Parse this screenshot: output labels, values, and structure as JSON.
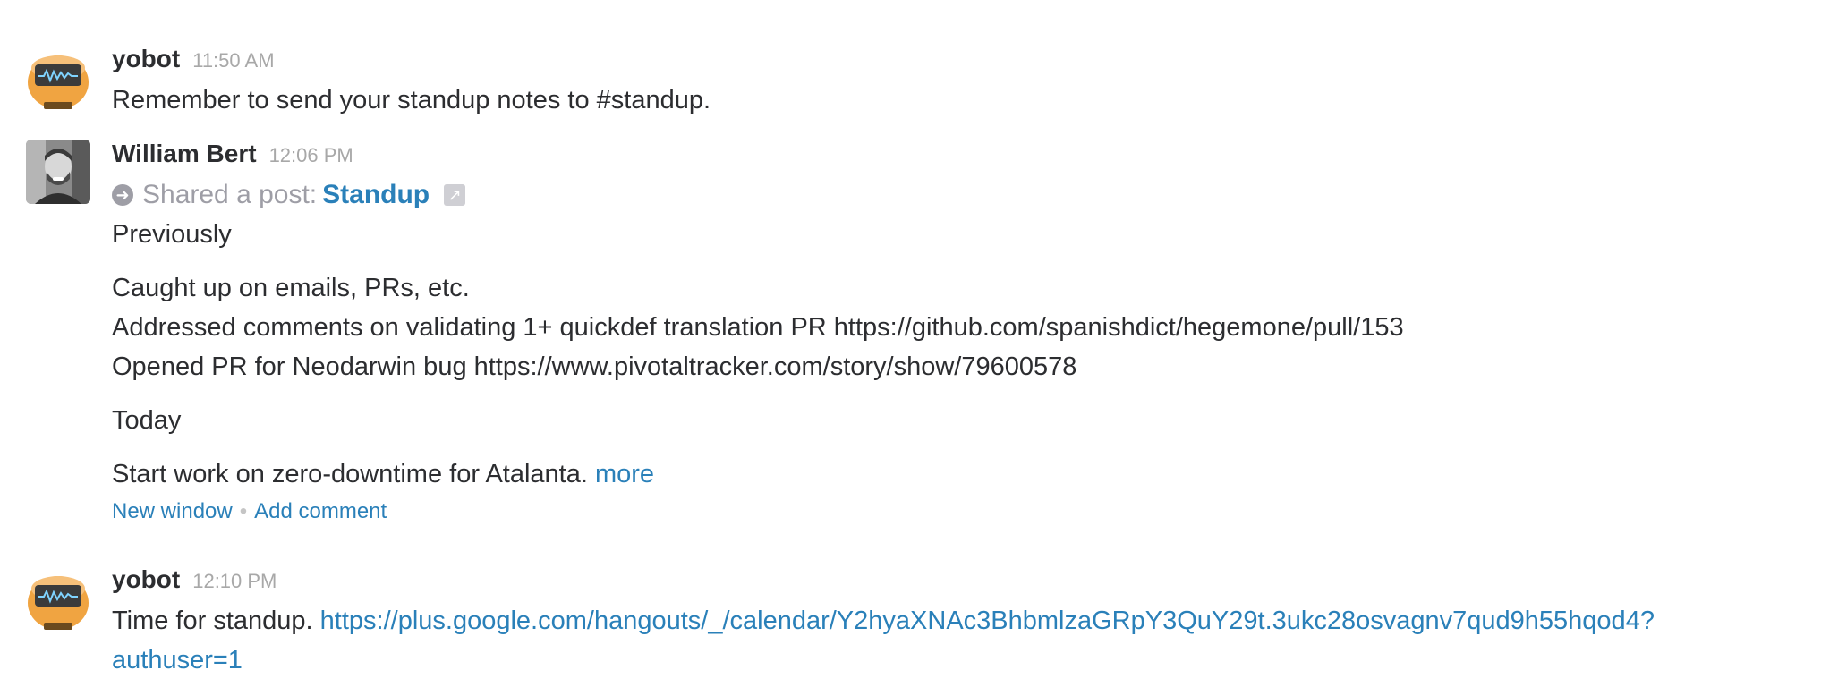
{
  "messages": [
    {
      "sender": "yobot",
      "time": "11:50 AM",
      "text": "Remember to send your standup notes to #standup."
    },
    {
      "sender": "William Bert",
      "time": "12:06 PM",
      "shared_prefix": "Shared a post:",
      "post_title": "Standup",
      "post_lines": {
        "heading1": "Previously",
        "line1": "Caught up on emails, PRs, etc.",
        "line2": "Addressed comments on validating 1+ quickdef translation PR https://github.com/spanishdict/hegemone/pull/153",
        "line3": "Opened PR for Neodarwin bug https://www.pivotaltracker.com/story/show/79600578",
        "heading2": "Today",
        "line4": "Start work on zero-downtime for Atalanta.",
        "more": "more"
      },
      "actions": {
        "new_window": "New window",
        "separator": "•",
        "add_comment": "Add comment"
      }
    },
    {
      "sender": "yobot",
      "time": "12:10 PM",
      "text": "Time for standup.",
      "link_part1": "https://plus.google.com/hangouts/_/calendar/Y2hyaXNAc3BhbmlzaGRpY3QuY29t.3ukc28osvagnv7qud9h55hqod4?",
      "link_part2": "authuser=1"
    }
  ],
  "icons": {
    "yobot_avatar": "robot-avatar-icon",
    "user_avatar": "person-photo-avatar",
    "share_arrow": "arrow-right-circle-icon",
    "external_link": "external-link-icon"
  },
  "colors": {
    "link": "#2a80b9",
    "muted": "#9e9ea6",
    "text": "#2c2d30",
    "robot_orange": "#f0a441"
  }
}
